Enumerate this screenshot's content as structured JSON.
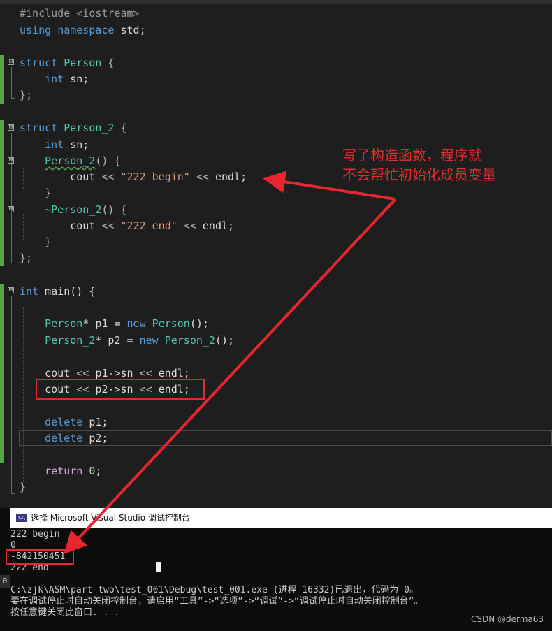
{
  "editor": {
    "lines": [
      {
        "parts": [
          [
            "pre",
            "#include "
          ],
          [
            "pre",
            "<iostream>"
          ]
        ]
      },
      {
        "parts": [
          [
            "kw",
            "using"
          ],
          [
            "id",
            " "
          ],
          [
            "kw",
            "namespace"
          ],
          [
            "id",
            " std;"
          ]
        ]
      },
      {
        "parts": [
          [
            "kw",
            "struct"
          ],
          [
            "id",
            " "
          ],
          [
            "ty",
            "Person"
          ],
          [
            "op",
            " {"
          ]
        ]
      },
      {
        "parts": [
          [
            "id",
            "    "
          ],
          [
            "kw",
            "int"
          ],
          [
            "id",
            " sn;"
          ]
        ]
      },
      {
        "parts": [
          [
            "op",
            "};"
          ]
        ]
      },
      {
        "parts": [
          [
            "kw",
            "struct"
          ],
          [
            "id",
            " "
          ],
          [
            "ty",
            "Person_2"
          ],
          [
            "op",
            " {"
          ]
        ]
      },
      {
        "parts": [
          [
            "id",
            "    "
          ],
          [
            "kw",
            "int"
          ],
          [
            "id",
            " sn;"
          ]
        ]
      },
      {
        "parts": [
          [
            "id",
            "    "
          ],
          [
            "ty squig",
            "Person_2"
          ],
          [
            "op",
            "() {"
          ]
        ]
      },
      {
        "parts": [
          [
            "id",
            "        cout "
          ],
          [
            "op",
            "<<"
          ],
          [
            "id",
            " "
          ],
          [
            "str",
            "\"222 begin\""
          ],
          [
            "id",
            " "
          ],
          [
            "op",
            "<<"
          ],
          [
            "id",
            " endl;"
          ]
        ]
      },
      {
        "parts": [
          [
            "op",
            "    }"
          ]
        ]
      },
      {
        "parts": [
          [
            "id",
            "    "
          ],
          [
            "op",
            "~"
          ],
          [
            "ty",
            "Person_2"
          ],
          [
            "op",
            "() {"
          ]
        ]
      },
      {
        "parts": [
          [
            "id",
            "        cout "
          ],
          [
            "op",
            "<<"
          ],
          [
            "id",
            " "
          ],
          [
            "str",
            "\"222 end\""
          ],
          [
            "id",
            " "
          ],
          [
            "op",
            "<<"
          ],
          [
            "id",
            " endl;"
          ]
        ]
      },
      {
        "parts": [
          [
            "op",
            "    }"
          ]
        ]
      },
      {
        "parts": [
          [
            "op",
            "};"
          ]
        ]
      },
      {
        "parts": [
          [
            "kw",
            "int"
          ],
          [
            "id",
            " main() {"
          ]
        ]
      },
      {
        "parts": [
          [
            "id",
            "    "
          ],
          [
            "ty",
            "Person"
          ],
          [
            "id",
            "* p1 = "
          ],
          [
            "kw",
            "new"
          ],
          [
            "id",
            " "
          ],
          [
            "ty",
            "Person"
          ],
          [
            "id",
            "();"
          ]
        ]
      },
      {
        "parts": [
          [
            "id",
            "    "
          ],
          [
            "ty",
            "Person_2"
          ],
          [
            "id",
            "* p2 = "
          ],
          [
            "kw",
            "new"
          ],
          [
            "id",
            " "
          ],
          [
            "ty",
            "Person_2"
          ],
          [
            "id",
            "();"
          ]
        ]
      },
      {
        "parts": [
          [
            "id",
            "    cout "
          ],
          [
            "op",
            "<<"
          ],
          [
            "id",
            " p1->sn "
          ],
          [
            "op",
            "<<"
          ],
          [
            "id",
            " endl;"
          ]
        ]
      },
      {
        "parts": [
          [
            "id",
            "    cout "
          ],
          [
            "op",
            "<<"
          ],
          [
            "id",
            " p2->sn "
          ],
          [
            "op",
            "<<"
          ],
          [
            "id",
            " endl;"
          ]
        ]
      },
      {
        "parts": [
          [
            "id",
            "    "
          ],
          [
            "kw",
            "delete"
          ],
          [
            "id",
            " p1;"
          ]
        ]
      },
      {
        "parts": [
          [
            "id",
            "    "
          ],
          [
            "kw",
            "delete"
          ],
          [
            "id",
            " p2;"
          ]
        ]
      },
      {
        "parts": [
          [
            "id",
            "    "
          ],
          [
            "ret",
            "return"
          ],
          [
            "id",
            " "
          ],
          [
            "num",
            "0"
          ],
          [
            "id",
            ";"
          ]
        ]
      },
      {
        "parts": [
          [
            "op",
            "}"
          ]
        ]
      }
    ],
    "fold_markers": [
      "⊟",
      "⊟",
      "⊟",
      "⊟",
      "⊟"
    ]
  },
  "annotation": {
    "line1": "写了构造函数，程序就",
    "line2": "不会帮忙初始化成员变量",
    "color": "#e03030"
  },
  "console": {
    "title": "选择 Microsoft Visual Studio 调试控制台",
    "icon_label": "C:\\",
    "output": [
      "222 begin",
      "0",
      "-842150451",
      "222 end",
      "",
      "C:\\zjk\\ASM\\part-two\\test_001\\Debug\\test_001.exe (进程 16332)已退出，代码为 0。",
      "要在调试停止时自动关闭控制台，请启用“工具”->“选项”->“调试”->“调试停止时自动关闭控制台”。",
      "按任意键关闭此窗口. . ."
    ],
    "side_label": "0"
  },
  "watermark": "CSDN @derma63",
  "colors": {
    "highlight": "#e8262f",
    "change_bar": "#57a64a",
    "background": "#1e1e1e"
  }
}
